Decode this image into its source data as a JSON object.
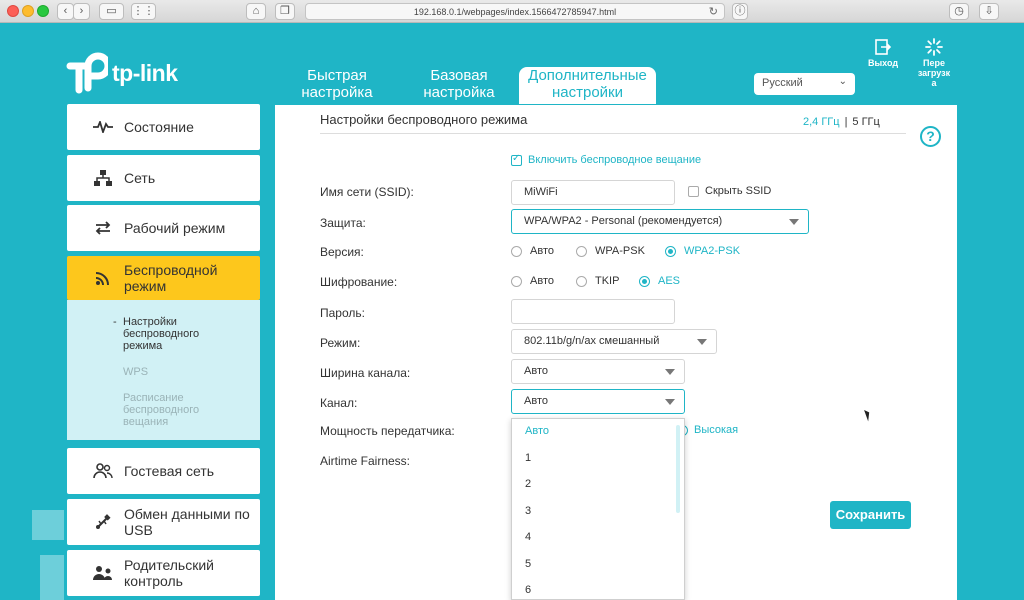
{
  "browser": {
    "url": "192.168.0.1/webpages/index.1566472785947.html"
  },
  "brand": {
    "name": "tp-link"
  },
  "topnav": [
    {
      "line1": "Быстрая",
      "line2": "настройка"
    },
    {
      "line1": "Базовая",
      "line2": "настройка"
    },
    {
      "line1": "Дополнительные",
      "line2": "настройки"
    }
  ],
  "language": {
    "value": "Русский"
  },
  "header_buttons": {
    "logout": "Выход",
    "reboot1": "Пере",
    "reboot2": "загрузк",
    "reboot3": "а"
  },
  "sidebar": {
    "items": [
      {
        "label": "Состояние"
      },
      {
        "label": "Сеть"
      },
      {
        "label": "Рабочий режим"
      },
      {
        "label1": "Беспроводной",
        "label2": "режим"
      },
      {
        "label": "Гостевая сеть"
      },
      {
        "label1": "Обмен данными по",
        "label2": "USB"
      },
      {
        "label1": "Родительский",
        "label2": "контроль"
      }
    ],
    "sub": {
      "settings1": "Настройки",
      "settings2": "беспроводного",
      "settings3": "режима",
      "wps": "WPS",
      "schedule1": "Расписание",
      "schedule2": "беспроводного",
      "schedule3": "вещания"
    }
  },
  "page": {
    "title": "Настройки беспроводного режима",
    "band_24": "2,4 ГГц",
    "band_sep": "|",
    "band_5": "5 ГГц",
    "help": "?",
    "enable_broadcast": "Включить беспроводное вещание",
    "ssid_label": "Имя сети (SSID):",
    "ssid_value": "MiWiFi",
    "hide_ssid": "Скрыть SSID",
    "security_label": "Защита:",
    "security_value": "WPA/WPA2 - Personal (рекомендуется)",
    "version_label": "Версия:",
    "version_options": [
      "Авто",
      "WPA-PSK",
      "WPA2-PSK"
    ],
    "encryption_label": "Шифрование:",
    "encryption_options": [
      "Авто",
      "TKIP",
      "AES"
    ],
    "password_label": "Пароль:",
    "password_value": "",
    "mode_label": "Режим:",
    "mode_value": "802.11b/g/n/ax смешанный",
    "width_label": "Ширина канала:",
    "width_value": "Авто",
    "channel_label": "Канал:",
    "channel_value": "Авто",
    "power_label": "Мощность передатчика:",
    "power_high": "Высокая",
    "airtime_label": "Airtime Fairness:",
    "save": "Сохранить"
  },
  "channel_dropdown": [
    "Авто",
    "1",
    "2",
    "3",
    "4",
    "5",
    "6"
  ],
  "colors": {
    "accent": "#1fb5c6",
    "active_nav": "#fdc71c"
  }
}
